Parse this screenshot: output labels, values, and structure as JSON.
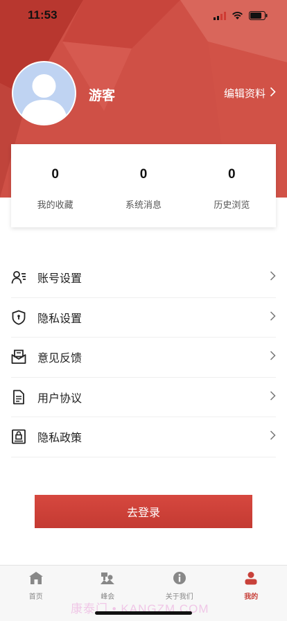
{
  "status_bar": {
    "time": "11:53"
  },
  "profile": {
    "username": "游客",
    "edit_label": "编辑资料"
  },
  "stats": [
    {
      "value": "0",
      "label": "我的收藏"
    },
    {
      "value": "0",
      "label": "系统消息"
    },
    {
      "value": "0",
      "label": "历史浏览"
    }
  ],
  "menu": [
    {
      "label": "账号设置",
      "icon": "user-settings-icon"
    },
    {
      "label": "隐私设置",
      "icon": "shield-icon"
    },
    {
      "label": "意见反馈",
      "icon": "mail-feedback-icon"
    },
    {
      "label": "用户协议",
      "icon": "document-icon"
    },
    {
      "label": "隐私政策",
      "icon": "lock-document-icon"
    }
  ],
  "login_button": "去登录",
  "tabbar": [
    {
      "label": "首页",
      "icon": "home-icon",
      "active": false
    },
    {
      "label": "峰会",
      "icon": "summit-icon",
      "active": false
    },
    {
      "label": "关于我们",
      "icon": "info-icon",
      "active": false
    },
    {
      "label": "我的",
      "icon": "person-icon",
      "active": true
    }
  ],
  "watermark": "康泰门 • KANGZM.COM",
  "colors": {
    "accent": "#cf5046",
    "button": "#c43a32",
    "active_tab": "#c8413a",
    "avatar_bg": "#bfd3f2"
  }
}
